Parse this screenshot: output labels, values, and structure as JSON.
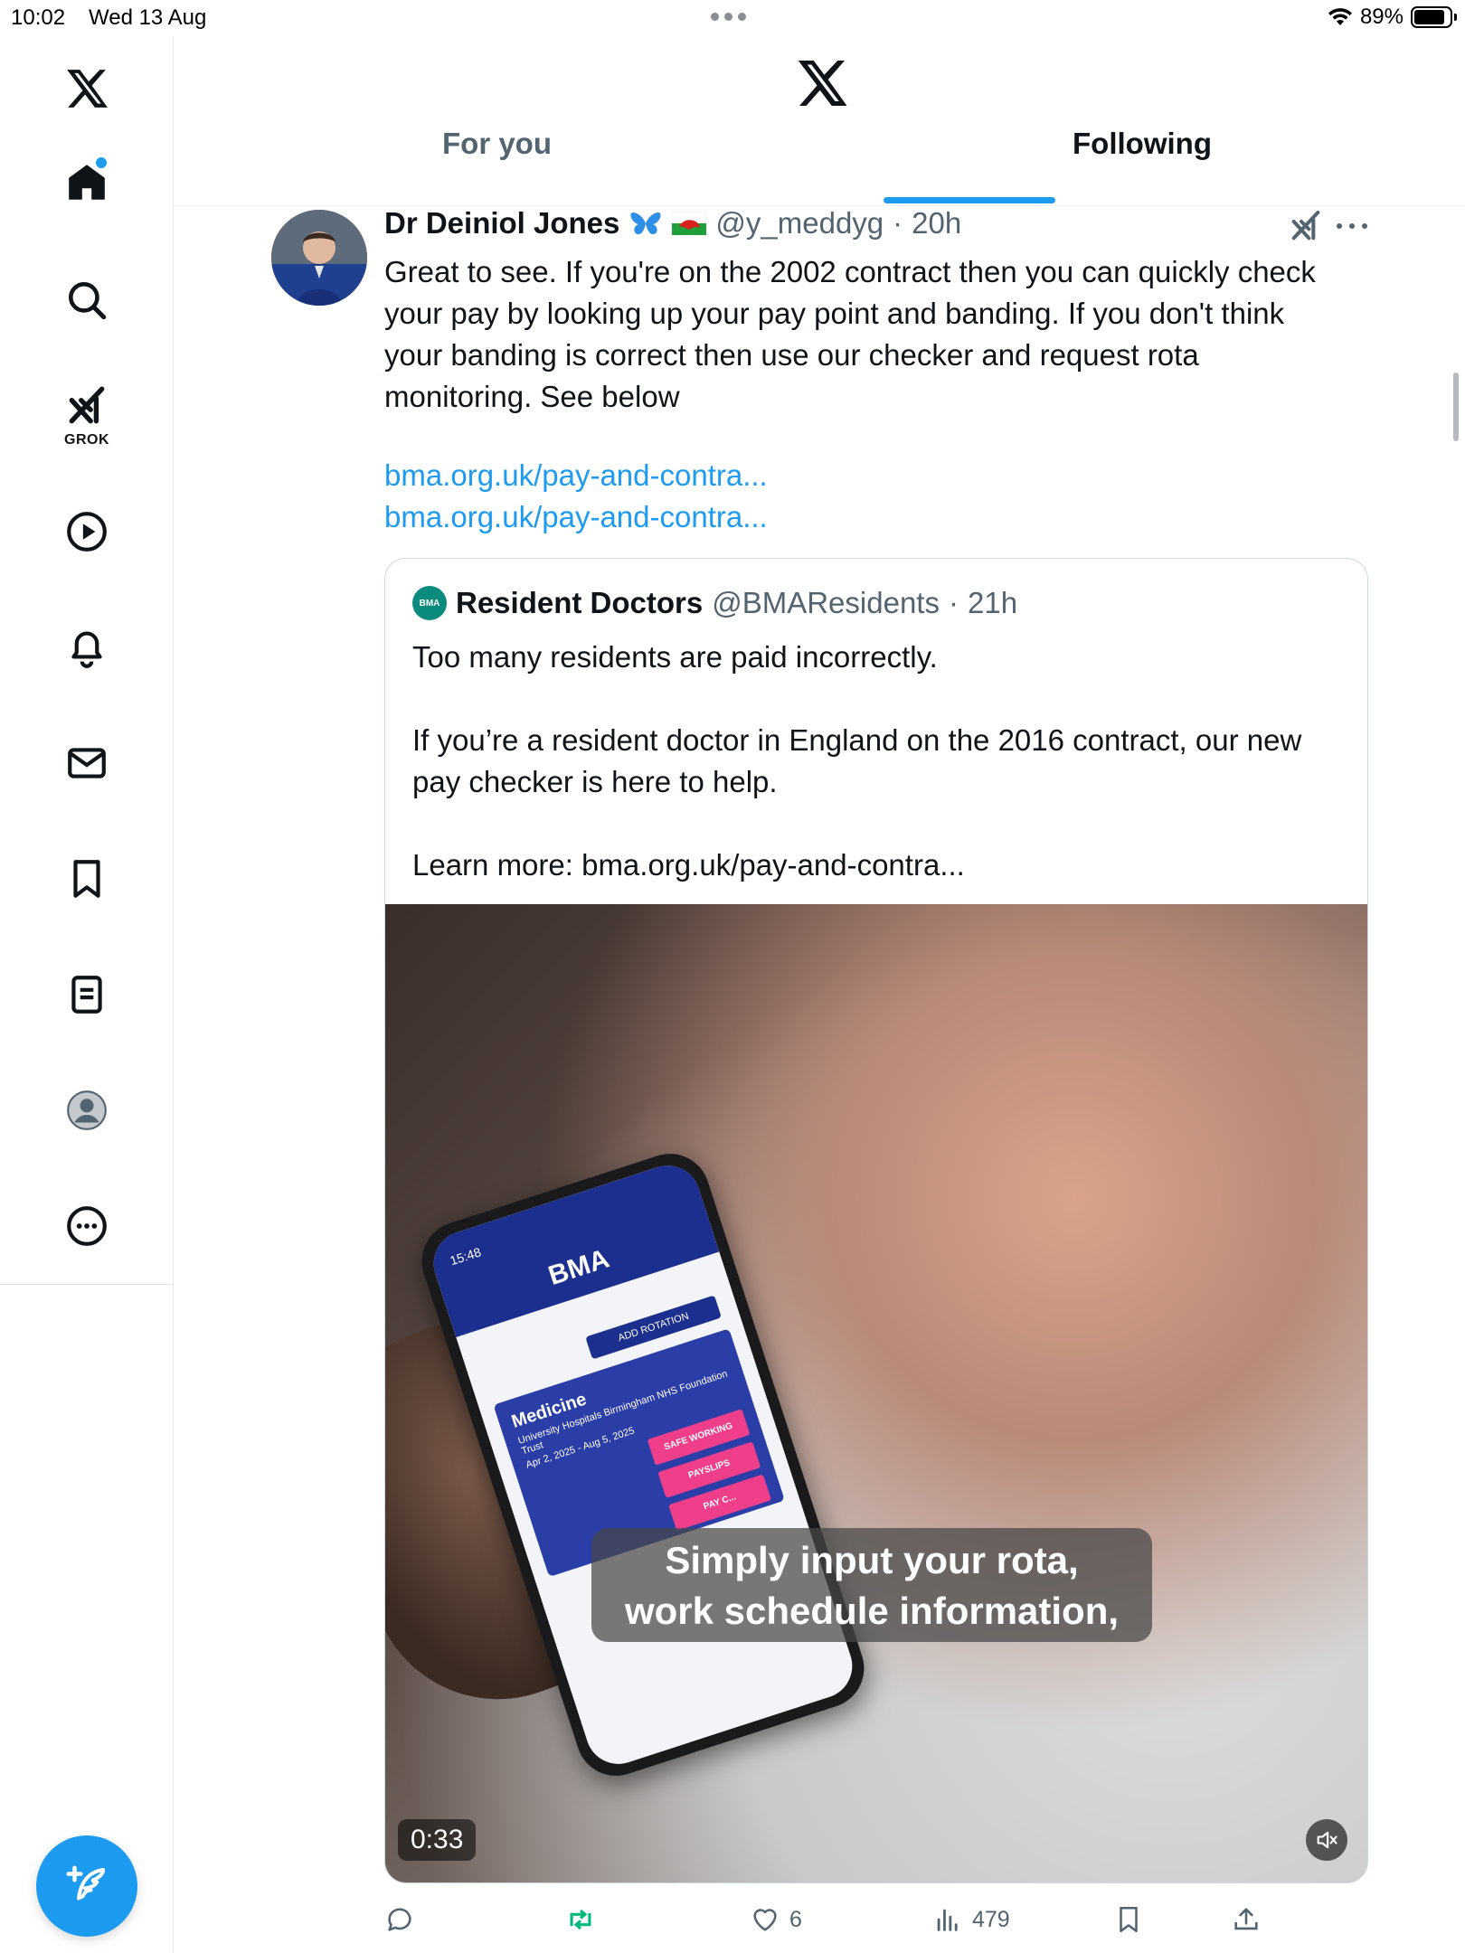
{
  "status_bar": {
    "time": "10:02",
    "date": "Wed 13 Aug",
    "battery": "89%"
  },
  "sidebar": {
    "items": [
      {
        "name": "home",
        "label": ""
      },
      {
        "name": "search",
        "label": ""
      },
      {
        "name": "grok",
        "label": "GROK"
      },
      {
        "name": "video",
        "label": ""
      },
      {
        "name": "notifications",
        "label": ""
      },
      {
        "name": "messages",
        "label": ""
      },
      {
        "name": "bookmarks",
        "label": ""
      },
      {
        "name": "lists",
        "label": ""
      },
      {
        "name": "profile",
        "label": ""
      },
      {
        "name": "more",
        "label": ""
      }
    ]
  },
  "header": {
    "tabs": [
      {
        "label": "For you",
        "active": false
      },
      {
        "label": "Following",
        "active": true
      }
    ]
  },
  "tweet": {
    "author_name": "Dr Deiniol Jones",
    "badges": [
      "butterfly",
      "welsh-flag"
    ],
    "handle": "@y_meddyg",
    "time": "20h",
    "text_lines": [
      "Great to see. If you're on the 2002 contract then you can quickly check",
      "your pay by looking up your pay point and banding. If you don't think",
      "your banding is correct then use our checker and request rota",
      "monitoring. See below"
    ],
    "links": [
      "bma.org.uk/pay-and-contra...",
      "bma.org.uk/pay-and-contra..."
    ],
    "quote": {
      "avatar_text": "BMA",
      "name": "Resident Doctors",
      "handle": "@BMAResidents",
      "time": "21h",
      "text_lines": [
        "Too many residents are paid incorrectly.",
        "",
        "If you’re a resident doctor in England on the 2016 contract, our new",
        "pay checker is here to help.",
        "",
        "Learn more: bma.org.uk/pay-and-contra..."
      ],
      "media": {
        "phone": {
          "time": "15:48",
          "logo": "BMA",
          "add_rotation": "ADD ROTATION",
          "card_title": "Medicine",
          "card_subtitle": "University Hospitals Birmingham NHS Foundation Trust",
          "card_dates": "Apr 2, 2025 - Aug 5, 2025",
          "buttons": [
            "SAFE WORKING",
            "PAYSLIPS",
            "PAY C..."
          ]
        },
        "caption_lines": [
          "Simply input your rota,",
          "work schedule information,"
        ],
        "duration": "0:33"
      }
    },
    "actions": {
      "reply_count": "",
      "repost_count": "",
      "like_count": "6",
      "views_count": "479"
    }
  },
  "colors": {
    "accent": "#1d9bf0",
    "repost_active": "#00ba7c",
    "text_primary": "#0f1419",
    "text_secondary": "#536471"
  }
}
